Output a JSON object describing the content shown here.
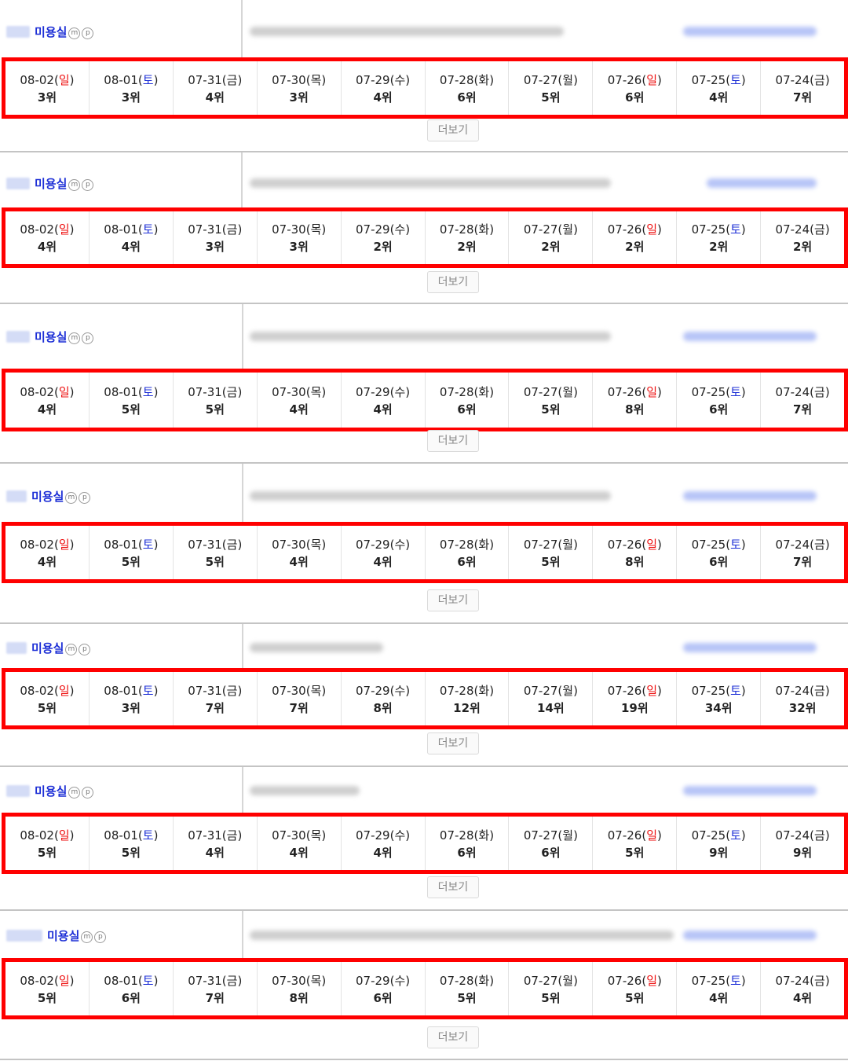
{
  "ui": {
    "more_label": "더보기",
    "badge_m": "m",
    "badge_p": "p"
  },
  "sections": [
    {
      "shop_name": "미용실",
      "rows": [
        {
          "date": "08-02",
          "weekday": "일",
          "type": "sun",
          "rank": "3위"
        },
        {
          "date": "08-01",
          "weekday": "토",
          "type": "sat",
          "rank": "3위"
        },
        {
          "date": "07-31",
          "weekday": "금",
          "type": "wk",
          "rank": "4위"
        },
        {
          "date": "07-30",
          "weekday": "목",
          "type": "wk",
          "rank": "3위"
        },
        {
          "date": "07-29",
          "weekday": "수",
          "type": "wk",
          "rank": "4위"
        },
        {
          "date": "07-28",
          "weekday": "화",
          "type": "wk",
          "rank": "6위"
        },
        {
          "date": "07-27",
          "weekday": "월",
          "type": "wk",
          "rank": "5위"
        },
        {
          "date": "07-26",
          "weekday": "일",
          "type": "sun",
          "rank": "6위"
        },
        {
          "date": "07-25",
          "weekday": "토",
          "type": "sat",
          "rank": "4위"
        },
        {
          "date": "07-24",
          "weekday": "금",
          "type": "wk",
          "rank": "7위"
        }
      ]
    },
    {
      "shop_name": "미용실",
      "rows": [
        {
          "date": "08-02",
          "weekday": "일",
          "type": "sun",
          "rank": "4위"
        },
        {
          "date": "08-01",
          "weekday": "토",
          "type": "sat",
          "rank": "4위"
        },
        {
          "date": "07-31",
          "weekday": "금",
          "type": "wk",
          "rank": "3위"
        },
        {
          "date": "07-30",
          "weekday": "목",
          "type": "wk",
          "rank": "3위"
        },
        {
          "date": "07-29",
          "weekday": "수",
          "type": "wk",
          "rank": "2위"
        },
        {
          "date": "07-28",
          "weekday": "화",
          "type": "wk",
          "rank": "2위"
        },
        {
          "date": "07-27",
          "weekday": "월",
          "type": "wk",
          "rank": "2위"
        },
        {
          "date": "07-26",
          "weekday": "일",
          "type": "sun",
          "rank": "2위"
        },
        {
          "date": "07-25",
          "weekday": "토",
          "type": "sat",
          "rank": "2위"
        },
        {
          "date": "07-24",
          "weekday": "금",
          "type": "wk",
          "rank": "2위"
        }
      ]
    },
    {
      "shop_name": "미용실",
      "rows": [
        {
          "date": "08-02",
          "weekday": "일",
          "type": "sun",
          "rank": "4위"
        },
        {
          "date": "08-01",
          "weekday": "토",
          "type": "sat",
          "rank": "5위"
        },
        {
          "date": "07-31",
          "weekday": "금",
          "type": "wk",
          "rank": "5위"
        },
        {
          "date": "07-30",
          "weekday": "목",
          "type": "wk",
          "rank": "4위"
        },
        {
          "date": "07-29",
          "weekday": "수",
          "type": "wk",
          "rank": "4위"
        },
        {
          "date": "07-28",
          "weekday": "화",
          "type": "wk",
          "rank": "6위"
        },
        {
          "date": "07-27",
          "weekday": "월",
          "type": "wk",
          "rank": "5위"
        },
        {
          "date": "07-26",
          "weekday": "일",
          "type": "sun",
          "rank": "8위"
        },
        {
          "date": "07-25",
          "weekday": "토",
          "type": "sat",
          "rank": "6위"
        },
        {
          "date": "07-24",
          "weekday": "금",
          "type": "wk",
          "rank": "7위"
        }
      ]
    },
    {
      "shop_name": "미용실",
      "rows": [
        {
          "date": "08-02",
          "weekday": "일",
          "type": "sun",
          "rank": "4위"
        },
        {
          "date": "08-01",
          "weekday": "토",
          "type": "sat",
          "rank": "5위"
        },
        {
          "date": "07-31",
          "weekday": "금",
          "type": "wk",
          "rank": "5위"
        },
        {
          "date": "07-30",
          "weekday": "목",
          "type": "wk",
          "rank": "4위"
        },
        {
          "date": "07-29",
          "weekday": "수",
          "type": "wk",
          "rank": "4위"
        },
        {
          "date": "07-28",
          "weekday": "화",
          "type": "wk",
          "rank": "6위"
        },
        {
          "date": "07-27",
          "weekday": "월",
          "type": "wk",
          "rank": "5위"
        },
        {
          "date": "07-26",
          "weekday": "일",
          "type": "sun",
          "rank": "8위"
        },
        {
          "date": "07-25",
          "weekday": "토",
          "type": "sat",
          "rank": "6위"
        },
        {
          "date": "07-24",
          "weekday": "금",
          "type": "wk",
          "rank": "7위"
        }
      ]
    },
    {
      "shop_name": "미용실",
      "rows": [
        {
          "date": "08-02",
          "weekday": "일",
          "type": "sun",
          "rank": "5위"
        },
        {
          "date": "08-01",
          "weekday": "토",
          "type": "sat",
          "rank": "3위"
        },
        {
          "date": "07-31",
          "weekday": "금",
          "type": "wk",
          "rank": "7위"
        },
        {
          "date": "07-30",
          "weekday": "목",
          "type": "wk",
          "rank": "7위"
        },
        {
          "date": "07-29",
          "weekday": "수",
          "type": "wk",
          "rank": "8위"
        },
        {
          "date": "07-28",
          "weekday": "화",
          "type": "wk",
          "rank": "12위"
        },
        {
          "date": "07-27",
          "weekday": "월",
          "type": "wk",
          "rank": "14위"
        },
        {
          "date": "07-26",
          "weekday": "일",
          "type": "sun",
          "rank": "19위"
        },
        {
          "date": "07-25",
          "weekday": "토",
          "type": "sat",
          "rank": "34위"
        },
        {
          "date": "07-24",
          "weekday": "금",
          "type": "wk",
          "rank": "32위"
        }
      ]
    },
    {
      "shop_name": "미용실",
      "rows": [
        {
          "date": "08-02",
          "weekday": "일",
          "type": "sun",
          "rank": "5위"
        },
        {
          "date": "08-01",
          "weekday": "토",
          "type": "sat",
          "rank": "5위"
        },
        {
          "date": "07-31",
          "weekday": "금",
          "type": "wk",
          "rank": "4위"
        },
        {
          "date": "07-30",
          "weekday": "목",
          "type": "wk",
          "rank": "4위"
        },
        {
          "date": "07-29",
          "weekday": "수",
          "type": "wk",
          "rank": "4위"
        },
        {
          "date": "07-28",
          "weekday": "화",
          "type": "wk",
          "rank": "6위"
        },
        {
          "date": "07-27",
          "weekday": "월",
          "type": "wk",
          "rank": "6위"
        },
        {
          "date": "07-26",
          "weekday": "일",
          "type": "sun",
          "rank": "5위"
        },
        {
          "date": "07-25",
          "weekday": "토",
          "type": "sat",
          "rank": "9위"
        },
        {
          "date": "07-24",
          "weekday": "금",
          "type": "wk",
          "rank": "9위"
        }
      ]
    },
    {
      "shop_name": "미용실",
      "rows": [
        {
          "date": "08-02",
          "weekday": "일",
          "type": "sun",
          "rank": "5위"
        },
        {
          "date": "08-01",
          "weekday": "토",
          "type": "sat",
          "rank": "6위"
        },
        {
          "date": "07-31",
          "weekday": "금",
          "type": "wk",
          "rank": "7위"
        },
        {
          "date": "07-30",
          "weekday": "목",
          "type": "wk",
          "rank": "8위"
        },
        {
          "date": "07-29",
          "weekday": "수",
          "type": "wk",
          "rank": "6위"
        },
        {
          "date": "07-28",
          "weekday": "화",
          "type": "wk",
          "rank": "5위"
        },
        {
          "date": "07-27",
          "weekday": "월",
          "type": "wk",
          "rank": "5위"
        },
        {
          "date": "07-26",
          "weekday": "일",
          "type": "sun",
          "rank": "5위"
        },
        {
          "date": "07-25",
          "weekday": "토",
          "type": "sat",
          "rank": "4위"
        },
        {
          "date": "07-24",
          "weekday": "금",
          "type": "wk",
          "rank": "4위"
        }
      ]
    }
  ],
  "colors": {
    "box_border": "#ff0000",
    "sunday": "#ee1111",
    "saturday": "#1d2fd6",
    "shop_name": "#1d2fd6"
  }
}
